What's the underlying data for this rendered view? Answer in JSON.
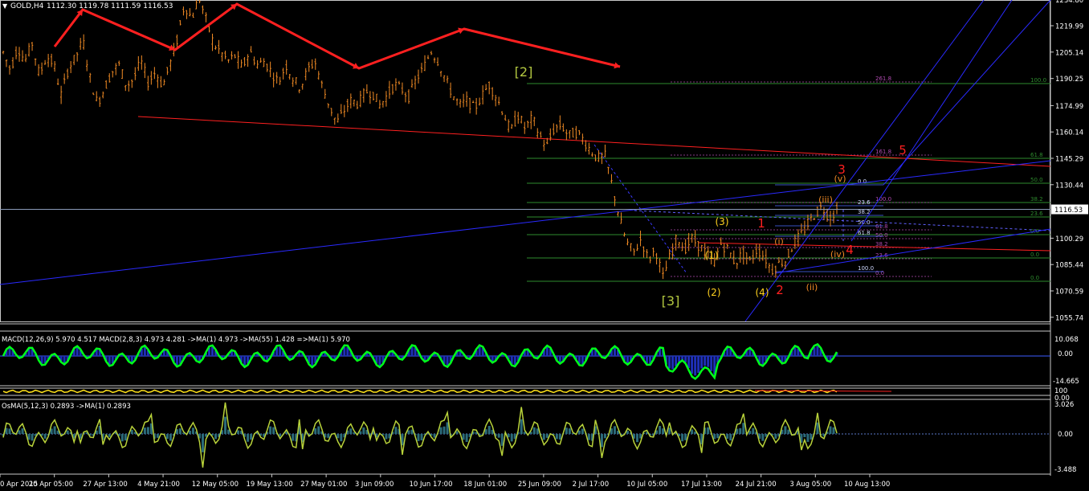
{
  "header": {
    "symbol": "GOLD,H4",
    "ohlc": "1112.30 1119.78 1111.59 1116.53"
  },
  "indicators": {
    "macd_label": "MACD(12,26,9) 5.970 4.517  MACD(2,8,3) 4.973 4.281  ->MA(1) 4.973  ->MA(55) 1.428  =>MA(1) 5.970",
    "macd_axis": [
      "10.068",
      "0.00",
      "-14.665"
    ],
    "sub_axis": [
      "100",
      "0.00"
    ],
    "osma_label": "OsMA(5,12,3) 0.2893  ->MA(1) 0.2893",
    "osma_axis": [
      "3.026",
      "0.00",
      "-3.488"
    ]
  },
  "colors": {
    "candle": "#f08a24",
    "trend_red": "#ff2020",
    "channel_blue": "#2a2aff",
    "fib_green": "#2e8b2e",
    "fib_purple": "#b04ab0",
    "wave_yellow": "#ffd21f",
    "wave_green": "#b3c840",
    "macd_green": "#00ff1a",
    "osma_green": "#b8d23a",
    "price_line": "#8a9ab8"
  },
  "chart_data": {
    "type": "candlestick",
    "symbol": "GOLD",
    "timeframe": "H4",
    "current_price": 1116.53,
    "ylim": [
      1050,
      1240
    ],
    "y_ticks": [
      1234.8,
      1219.99,
      1205.14,
      1190.25,
      1174.99,
      1160.14,
      1145.29,
      1130.44,
      1116.53,
      1100.29,
      1085.44,
      1070.59,
      1055.74
    ],
    "x_ticks": [
      "0 Apr 2015",
      "20 Apr 05:00",
      "27 Apr 13:00",
      "4 May 21:00",
      "12 May 05:00",
      "19 May 13:00",
      "27 May 01:00",
      "3 Jun 09:00",
      "10 Jun 17:00",
      "18 Jun 01:00",
      "25 Jun 09:00",
      "2 Jul 17:00",
      "10 Jul 05:00",
      "17 Jul 13:00",
      "24 Jul 21:00",
      "3 Aug 05:00",
      "10 Aug 13:00"
    ],
    "price_path": [
      1205,
      1195,
      1208,
      1200,
      1210,
      1192,
      1203,
      1198,
      1181,
      1196,
      1202,
      1212,
      1190,
      1176,
      1185,
      1194,
      1198,
      1186,
      1190,
      1200,
      1188,
      1194,
      1186,
      1198,
      1212,
      1232,
      1224,
      1236,
      1223,
      1210,
      1205,
      1200,
      1203,
      1196,
      1206,
      1198,
      1200,
      1194,
      1188,
      1198,
      1190,
      1185,
      1195,
      1200,
      1186,
      1175,
      1165,
      1172,
      1178,
      1176,
      1183,
      1182,
      1175,
      1181,
      1187,
      1184,
      1180,
      1190,
      1196,
      1206,
      1200,
      1190,
      1181,
      1175,
      1178,
      1173,
      1180,
      1187,
      1180,
      1171,
      1160,
      1170,
      1162,
      1168,
      1158,
      1152,
      1162,
      1164,
      1158,
      1160,
      1156,
      1150,
      1145,
      1147,
      1130,
      1112,
      1098,
      1092,
      1100,
      1088,
      1094,
      1078,
      1090,
      1101,
      1094,
      1100,
      1096,
      1092,
      1086,
      1097,
      1094,
      1086,
      1092,
      1087,
      1094,
      1090,
      1082,
      1086,
      1088,
      1097,
      1102,
      1108,
      1114,
      1118,
      1112,
      1116
    ],
    "wave_labels": [
      "[2]",
      "[3]",
      "(1)",
      "(2)",
      "(3)",
      "(4)",
      "1",
      "2",
      "3",
      "4",
      "5",
      "(i)",
      "(ii)",
      "(iii)",
      "(iv)",
      "(v)"
    ],
    "fib_levels_left": [
      "261.8",
      "161.8",
      "100.0",
      "61.8",
      "50.0",
      "38.2",
      "23.6",
      "0.0"
    ],
    "fib_levels_inner": [
      "0.0",
      "23.6",
      "38.2",
      "50.0",
      "61.8",
      "100.0"
    ],
    "fib_levels_right": [
      "100.0",
      "61.8",
      "50.0",
      "38.2",
      "23.6",
      "0.0"
    ],
    "macd_range": [
      -14.665,
      10.068
    ],
    "osma_range": [
      -3.488,
      3.026
    ],
    "grid": false
  }
}
